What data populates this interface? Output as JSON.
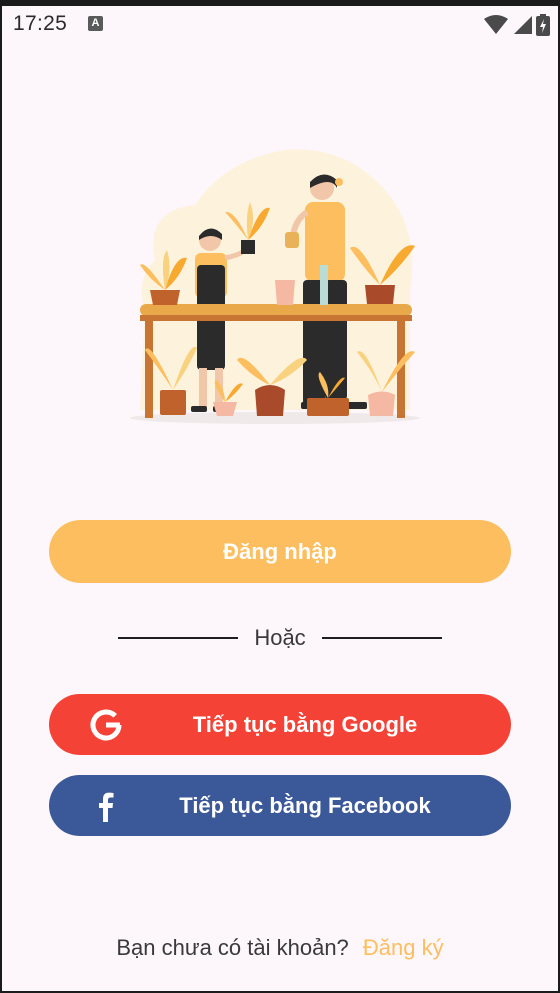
{
  "status_bar": {
    "time": "17:25",
    "notification_icon": "a-letter-icon",
    "icons": [
      "wifi-icon",
      "signal-icon",
      "battery-icon"
    ]
  },
  "illustration": {
    "icon": "gardeners-illustration"
  },
  "login_button": {
    "label": "Đăng nhập"
  },
  "divider": {
    "label": "Hoặc"
  },
  "google_button": {
    "label": "Tiếp tục bằng Google",
    "icon": "google-icon"
  },
  "facebook_button": {
    "label": "Tiếp tục bằng Facebook",
    "icon": "facebook-icon"
  },
  "signup": {
    "prompt": "Bạn chưa có tài khoản?",
    "link": "Đăng ký"
  },
  "colors": {
    "background": "#fdf6fb",
    "primary": "#fdbe5f",
    "google": "#f44336",
    "facebook": "#3b5998"
  }
}
